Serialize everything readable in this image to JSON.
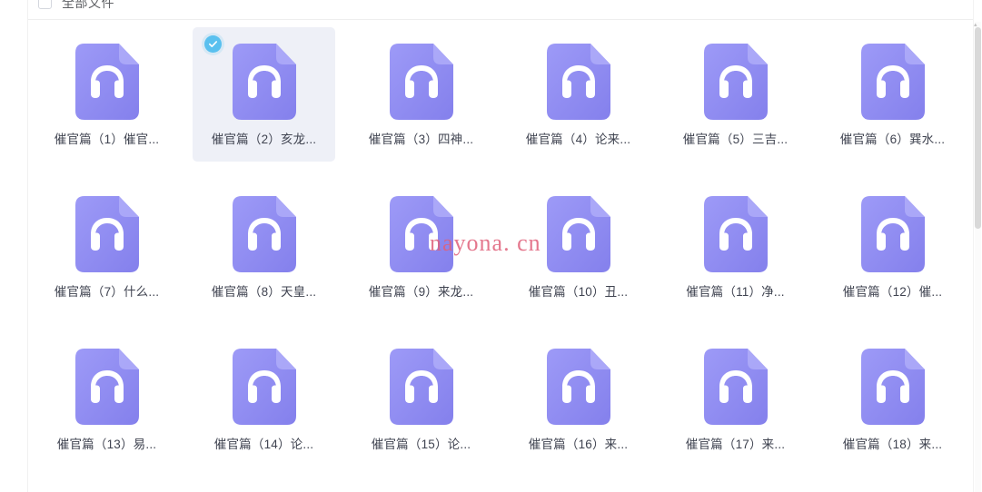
{
  "header": {
    "select_all_label": "全部文件",
    "checkbox_checked": false
  },
  "watermark": {
    "text": "nayona. cn",
    "color": "#e0607a"
  },
  "theme": {
    "icon_purple_light": "#9a97f5",
    "icon_purple_dark": "#8480ec",
    "selected_bg": "#eef0f7",
    "check_badge_blue": "#59c0ef",
    "label_color": "#3f4350"
  },
  "grid": {
    "columns": 6,
    "file_type_icon": "audio-file-icon",
    "items": [
      {
        "label": "催官篇（1）催官...",
        "selected": false,
        "icon": "audio-file-icon"
      },
      {
        "label": "催官篇（2）亥龙...",
        "selected": true,
        "icon": "audio-file-icon"
      },
      {
        "label": "催官篇（3）四神...",
        "selected": false,
        "icon": "audio-file-icon"
      },
      {
        "label": "催官篇（4）论来...",
        "selected": false,
        "icon": "audio-file-icon"
      },
      {
        "label": "催官篇（5）三吉...",
        "selected": false,
        "icon": "audio-file-icon"
      },
      {
        "label": "催官篇（6）巽水...",
        "selected": false,
        "icon": "audio-file-icon"
      },
      {
        "label": "催官篇（7）什么...",
        "selected": false,
        "icon": "audio-file-icon"
      },
      {
        "label": "催官篇（8）天皇...",
        "selected": false,
        "icon": "audio-file-icon"
      },
      {
        "label": "催官篇（9）来龙...",
        "selected": false,
        "icon": "audio-file-icon"
      },
      {
        "label": "催官篇（10）丑...",
        "selected": false,
        "icon": "audio-file-icon"
      },
      {
        "label": "催官篇（11）净...",
        "selected": false,
        "icon": "audio-file-icon"
      },
      {
        "label": "催官篇（12）催...",
        "selected": false,
        "icon": "audio-file-icon"
      },
      {
        "label": "催官篇（13）易...",
        "selected": false,
        "icon": "audio-file-icon"
      },
      {
        "label": "催官篇（14）论...",
        "selected": false,
        "icon": "audio-file-icon"
      },
      {
        "label": "催官篇（15）论...",
        "selected": false,
        "icon": "audio-file-icon"
      },
      {
        "label": "催官篇（16）来...",
        "selected": false,
        "icon": "audio-file-icon"
      },
      {
        "label": "催官篇（17）来...",
        "selected": false,
        "icon": "audio-file-icon"
      },
      {
        "label": "催官篇（18）来...",
        "selected": false,
        "icon": "audio-file-icon"
      }
    ]
  }
}
